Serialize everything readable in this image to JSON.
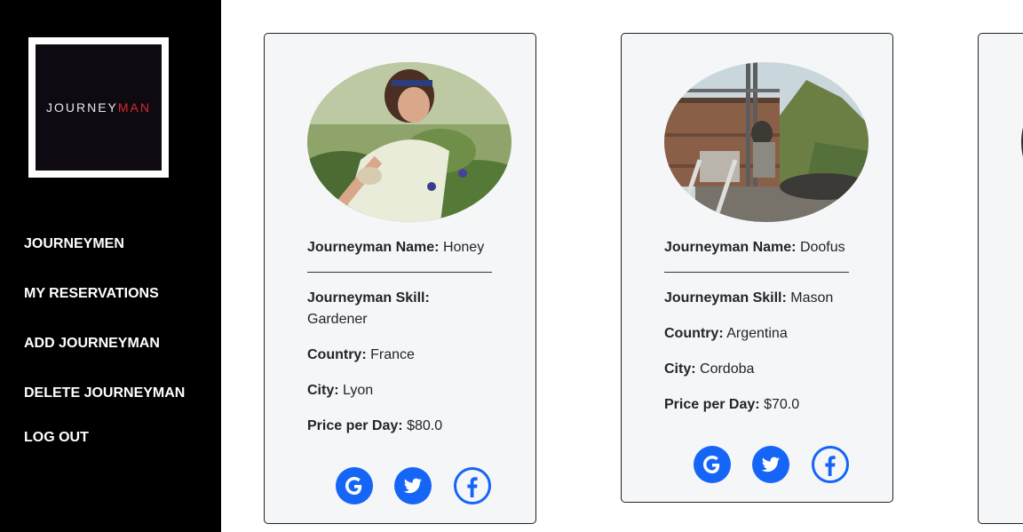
{
  "sidebar": {
    "logo": {
      "text_part1": "JOURNEY",
      "text_part2": "MAN"
    },
    "nav": [
      {
        "label": "JOURNEYMEN"
      },
      {
        "label": "MY RESERVATIONS"
      },
      {
        "label": "ADD JOURNEYMAN"
      },
      {
        "label": "DELETE JOURNEYMAN"
      },
      {
        "label": "LOG OUT"
      }
    ]
  },
  "labels": {
    "name": "Journeyman Name:",
    "skill": "Journeyman Skill:",
    "country": "Country:",
    "city": "City:",
    "price": "Price per Day:"
  },
  "cards": [
    {
      "name": "Honey",
      "skill": "Gardener",
      "country": "France",
      "city": "Lyon",
      "price": "$80.0",
      "photo": "gardener-photo"
    },
    {
      "name": "Doofus",
      "skill": "Mason",
      "country": "Argentina",
      "city": "Cordoba",
      "price": "$70.0",
      "photo": "mason-photo"
    }
  ],
  "social_icons": [
    "google-icon",
    "twitter-icon",
    "facebook-icon"
  ],
  "colors": {
    "accent": "#1565f7",
    "sidebar_bg": "#000000",
    "card_bg": "#f5f6f8",
    "logo_red": "#d7282e"
  }
}
